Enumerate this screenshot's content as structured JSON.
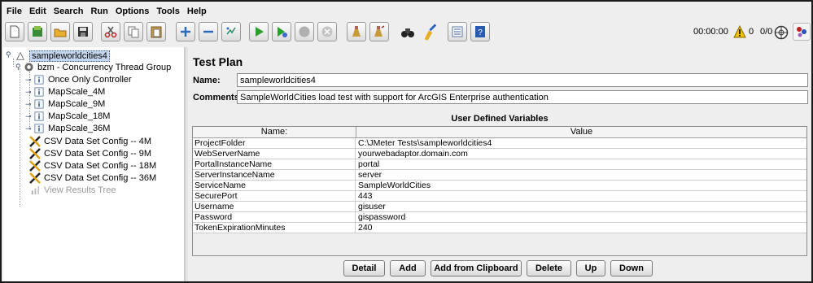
{
  "menu": [
    "File",
    "Edit",
    "Search",
    "Run",
    "Options",
    "Tools",
    "Help"
  ],
  "status": {
    "timer": "00:00:00",
    "warnings": "0",
    "threads": "0/0"
  },
  "tree": {
    "root": "sampleworldcities4",
    "thread_group": "bzm - Concurrency Thread Group",
    "controllers": [
      "Once Only Controller",
      "MapScale_4M",
      "MapScale_9M",
      "MapScale_18M",
      "MapScale_36M"
    ],
    "csv_configs": [
      "CSV Data Set Config -- 4M",
      "CSV Data Set Config -- 9M",
      "CSV Data Set Config -- 18M",
      "CSV Data Set Config -- 36M"
    ],
    "listener": "View Results Tree"
  },
  "panel": {
    "title": "Test Plan",
    "name_label": "Name:",
    "name_value": "sampleworldcities4",
    "comments_label": "Comments:",
    "comments_value": "SampleWorldCities load test with support for ArcGIS Enterprise authentication",
    "udv_title": "User Defined Variables",
    "col_name": "Name:",
    "col_value": "Value"
  },
  "variables": [
    {
      "name": "ProjectFolder",
      "value": "C:\\JMeter Tests\\sampleworldcities4"
    },
    {
      "name": "WebServerName",
      "value": "yourwebadaptor.domain.com"
    },
    {
      "name": "PortalInstanceName",
      "value": "portal"
    },
    {
      "name": "ServerInstanceName",
      "value": "server"
    },
    {
      "name": "ServiceName",
      "value": "SampleWorldCities"
    },
    {
      "name": "SecurePort",
      "value": "443"
    },
    {
      "name": "Username",
      "value": "gisuser"
    },
    {
      "name": "Password",
      "value": "gispassword"
    },
    {
      "name": "TokenExpirationMinutes",
      "value": "240"
    }
  ],
  "buttons": {
    "detail": "Detail",
    "add": "Add",
    "add_clipboard": "Add from Clipboard",
    "delete": "Delete",
    "up": "Up",
    "down": "Down"
  }
}
